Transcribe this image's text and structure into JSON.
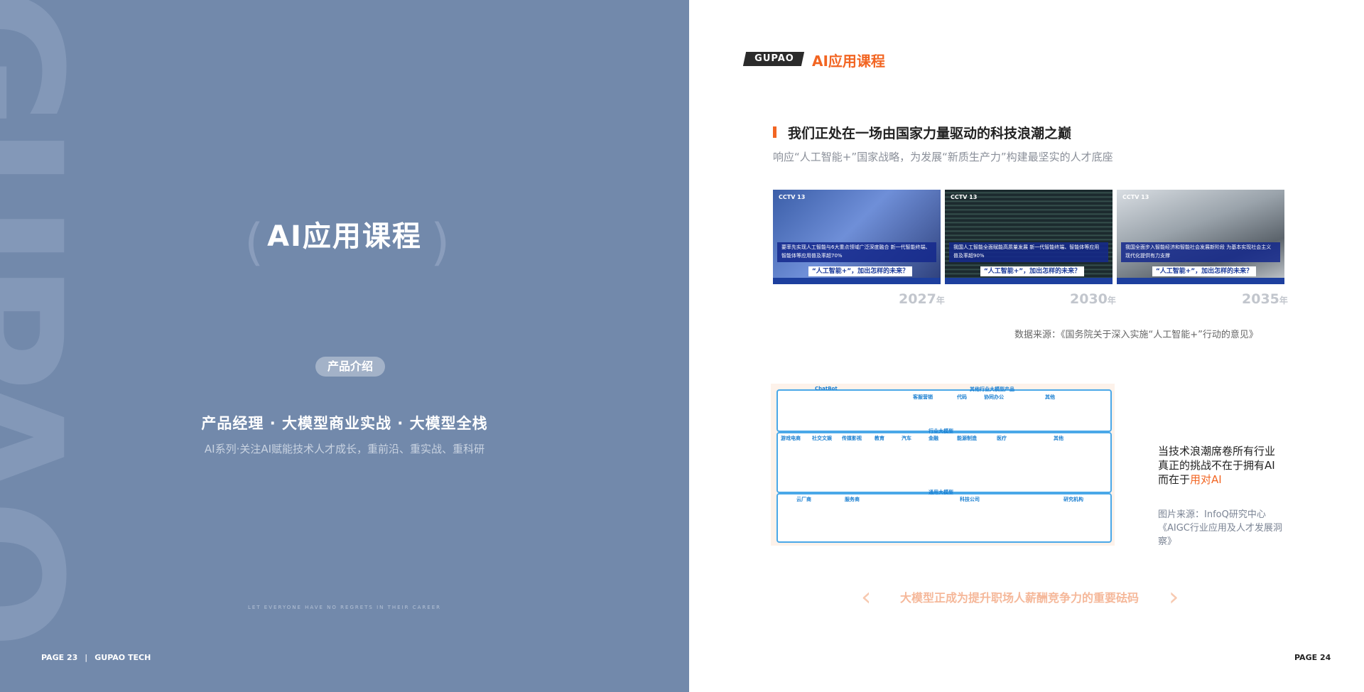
{
  "left_page": {
    "watermark": "GUPAO",
    "title": "AI应用课程",
    "tag": "产品介绍",
    "subtitle": "产品经理 · 大模型商业实战 · 大模型全栈",
    "description": "AI系列·关注AI赋能技术人才成长，重前沿、重实战、重科研",
    "slogan": "LET EVERYONE HAVE NO REGRETS IN THEIR CAREER",
    "footer": {
      "page": "PAGE  23",
      "brand": "GUPAO TECH"
    }
  },
  "right_page": {
    "logo": "GUPAO",
    "brand_title": "AI应用课程",
    "section_title": "我们正处在一场由国家力量驱动的科技浪潮之巅",
    "section_subtitle": "响应“人工智能+”国家战略，为发展“新质生产力”构建最坚实的人才底座",
    "news_shots": [
      {
        "channel": "CCTV 13",
        "caption": "要率先实现人工智能与6大重点领域广泛深度融合 新一代智能终端、智能体等应用普及率超70%",
        "banner": "“人工智能+”，加出怎样的未来？",
        "year": "2027",
        "year_unit": "年"
      },
      {
        "channel": "CCTV 13",
        "caption": "我国人工智能全面赋能高质量发展 新一代智能终端、智能体等应用普及率超90%",
        "banner": "“人工智能+”，加出怎样的未来？",
        "year": "2030",
        "year_unit": "年"
      },
      {
        "channel": "CCTV 13",
        "caption": "我国全面步入智能经济和智能社会发展新阶段 为基本实现社会主义现代化提供有力支撑",
        "banner": "“人工智能+”，加出怎样的未来？",
        "year": "2035",
        "year_unit": "年"
      }
    ],
    "data_source": "数据来源：《国务院关于深入实施“人工智能+”行动的意见》",
    "industry_map": {
      "top_groups": [
        "ChatBot",
        "其他行业大模型产品",
        "客服营销",
        "代码",
        "协同办公",
        "其他"
      ],
      "mid_title": "行业大模型",
      "mid_groups": [
        "游戏电商",
        "社交文娱",
        "传媒影视",
        "教育",
        "汽车",
        "金融",
        "能源制造",
        "医疗",
        "其他"
      ],
      "bottom_title": "通用大模型",
      "bottom_groups": [
        "云厂商",
        "服务商",
        "科技公司",
        "研究机构"
      ]
    },
    "side_text_prefix": "当技术浪潮席卷所有行业 真正的挑战不在于拥有AI 而在于",
    "side_text_highlight": "用对AI",
    "image_source": "图片来源：InfoQ研究中心《AIGC行业应用及人才发展洞察》",
    "banner": "大模型正成为提升职场人薪酬竞争力的重要砝码",
    "footer_page": "PAGE  24"
  },
  "colors": {
    "left_bg": "#7289ab",
    "accent": "#f26522",
    "map_border": "#4aa8e8"
  }
}
